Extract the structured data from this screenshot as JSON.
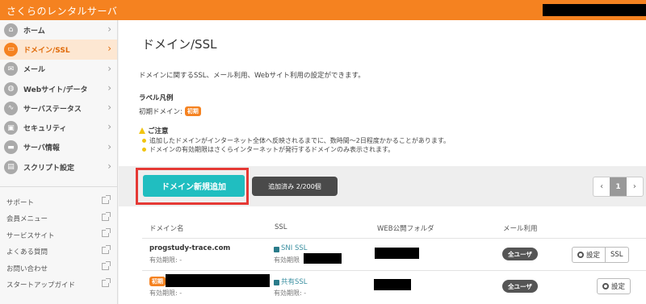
{
  "app": {
    "brand": "さくらのレンタルサーバ"
  },
  "sidebar": {
    "items": [
      {
        "label": "ホーム",
        "icon": "home-icon",
        "glyph": "⌂"
      },
      {
        "label": "ドメイン/SSL",
        "icon": "domain-icon",
        "glyph": "▭",
        "active": true
      },
      {
        "label": "メール",
        "icon": "mail-icon",
        "glyph": "✉"
      },
      {
        "label": "Webサイト/データ",
        "icon": "globe-icon",
        "glyph": "◍"
      },
      {
        "label": "サーバステータス",
        "icon": "status-chart-icon",
        "glyph": "∿"
      },
      {
        "label": "セキュリティ",
        "icon": "lock-icon",
        "glyph": "▣"
      },
      {
        "label": "サーバ情報",
        "icon": "server-info-icon",
        "glyph": "▬"
      },
      {
        "label": "スクリプト設定",
        "icon": "script-icon",
        "glyph": "▤"
      }
    ],
    "links": [
      {
        "label": "サポート"
      },
      {
        "label": "会員メニュー"
      },
      {
        "label": "サービスサイト"
      },
      {
        "label": "よくある質問"
      },
      {
        "label": "お問い合わせ"
      },
      {
        "label": "スタートアップガイド"
      }
    ]
  },
  "main": {
    "title": "ドメイン/SSL",
    "description": "ドメインに関するSSL、メール利用、Webサイト利用の設定ができます。",
    "legend": {
      "heading": "ラベル凡例",
      "label": "初期ドメイン:",
      "badge": "初期"
    },
    "notice": {
      "heading": "ご注意",
      "items": [
        "追加したドメインがインターネット全体へ反映されるまでに、数時間〜2日程度かかることがあります。",
        "ドメインの有効期限はさくらインターネットが発行するドメインのみ表示されます。"
      ]
    },
    "toolbar": {
      "add_button": "ドメイン新規追加",
      "count": "追加済み 2/200個",
      "pager": {
        "prev": "‹",
        "current": "1",
        "next": "›"
      }
    },
    "table": {
      "headers": [
        "ドメイン名",
        "SSL",
        "WEB公開フォルダ",
        "メール利用"
      ],
      "rows": [
        {
          "domain": "progstudy-trace.com",
          "expiry": "有効期限: -",
          "ssl": "SNI SSL",
          "ssl_expiry": "有効期限",
          "mail": "全ユーザ",
          "btn_settings": "設定",
          "btn_ssl": "SSL"
        },
        {
          "badge": "初期",
          "expiry": "有効期限: -",
          "ssl": "共有SSL",
          "ssl_expiry": "有効期限: -",
          "mail": "全ユーザ",
          "btn_settings": "設定"
        }
      ]
    }
  },
  "colors": {
    "header": "#f58220",
    "accent_teal": "#20bec0",
    "highlight_red": "#e53935"
  }
}
